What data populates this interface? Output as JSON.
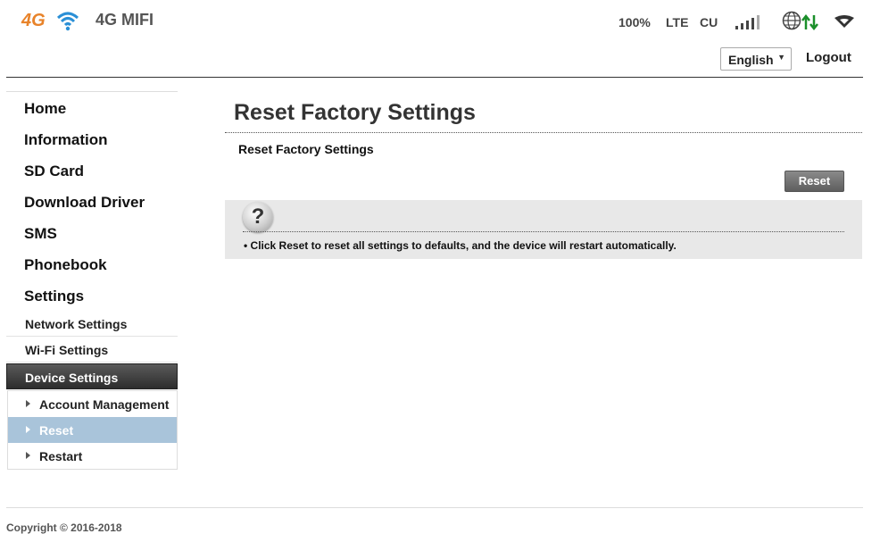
{
  "header": {
    "logo_text": "4G",
    "brand": "4G MIFI",
    "battery": "100%",
    "network_type": "LTE",
    "carrier": "CU",
    "language": "English",
    "logout_label": "Logout",
    "icons": [
      "logo-wifi-icon",
      "signal-bars-icon",
      "globe-icon",
      "data-transfer-icon",
      "wifi-status-icon"
    ]
  },
  "sidebar": {
    "items": [
      {
        "label": "Home"
      },
      {
        "label": "Information"
      },
      {
        "label": "SD Card"
      },
      {
        "label": "Download Driver"
      },
      {
        "label": "SMS"
      },
      {
        "label": "Phonebook"
      },
      {
        "label": "Settings"
      }
    ],
    "settings_subitems": [
      {
        "label": "Network Settings"
      },
      {
        "label": "Wi-Fi Settings"
      },
      {
        "label": "Device Settings",
        "active": true
      }
    ],
    "device_subitems": [
      {
        "label": "Account Management"
      },
      {
        "label": "Reset",
        "active": true
      },
      {
        "label": "Restart"
      }
    ]
  },
  "main": {
    "title": "Reset Factory Settings",
    "section_label": "Reset Factory Settings",
    "reset_button": "Reset",
    "help": {
      "icon_glyph": "?",
      "text": "• Click Reset to reset all settings to defaults, and the device will restart automatically."
    }
  },
  "footer": {
    "copyright": "Copyright © 2016-2018"
  },
  "colors": {
    "logo_orange": "#e8832a",
    "wifi_blue": "#2a8fd6",
    "transfer_green": "#1a8f2a",
    "active_subitem_bg": "#a9c4da",
    "button_gray": "#6e6e6e"
  }
}
